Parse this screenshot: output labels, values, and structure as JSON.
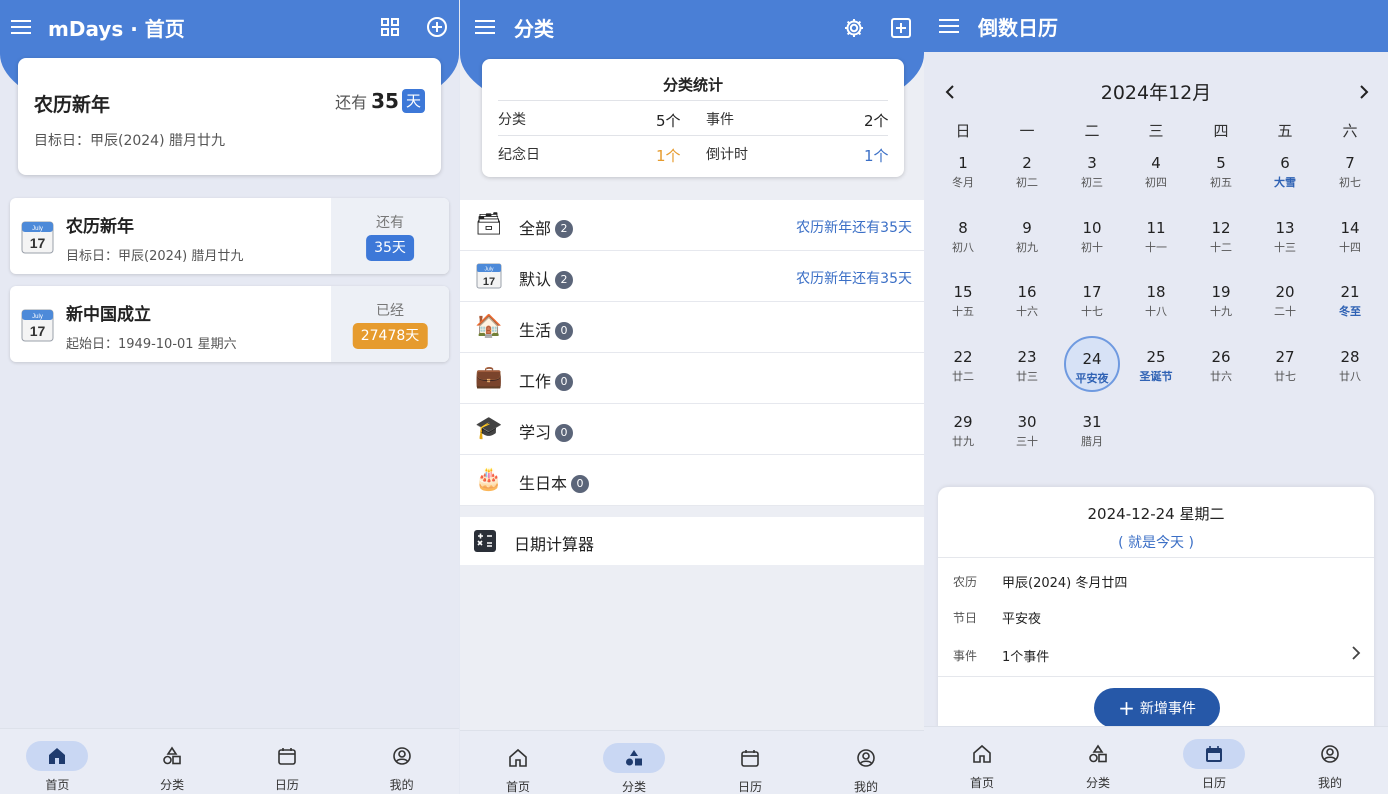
{
  "home": {
    "title": "mDays · 首页",
    "hero": {
      "name": "农历新年",
      "prefix": "还有",
      "days": "35",
      "unit": "天",
      "sub": "目标日：甲辰(2024) 腊月廿九"
    },
    "events": [
      {
        "name": "农历新年",
        "sub": "目标日：甲辰(2024) 腊月廿九",
        "label": "还有",
        "days": "35天",
        "color": "blue"
      },
      {
        "name": "新中国成立",
        "sub": "起始日：1949-10-01 星期六",
        "label": "已经",
        "days": "27478天",
        "color": "orange"
      }
    ]
  },
  "category": {
    "title": "分类",
    "stats": {
      "title": "分类统计",
      "r1": {
        "k1": "分类",
        "v1": "5个",
        "k2": "事件",
        "v2": "2个"
      },
      "r2": {
        "k1": "纪念日",
        "v1": "1个",
        "k2": "倒计时",
        "v2": "1个"
      }
    },
    "items": [
      {
        "name": "全部",
        "count": "2",
        "right": "农历新年还有35天",
        "icon": "archive-icon",
        "glyph": "🗃"
      },
      {
        "name": "默认",
        "count": "2",
        "right": "农历新年还有35天",
        "icon": "calendar-icon",
        "glyph": ""
      },
      {
        "name": "生活",
        "count": "0",
        "right": "",
        "icon": "house-icon",
        "glyph": "🏠"
      },
      {
        "name": "工作",
        "count": "0",
        "right": "",
        "icon": "briefcase-icon",
        "glyph": "💼"
      },
      {
        "name": "学习",
        "count": "0",
        "right": "",
        "icon": "graduation-cap-icon",
        "glyph": "🎓"
      },
      {
        "name": "生日本",
        "count": "0",
        "right": "",
        "icon": "birthday-cake-icon",
        "glyph": "🎂"
      }
    ],
    "calculator": "日期计算器"
  },
  "calendar": {
    "title": "倒数日历",
    "month": "2024年12月",
    "weekdays": [
      "日",
      "一",
      "二",
      "三",
      "四",
      "五",
      "六"
    ],
    "days": [
      {
        "n": "1",
        "l": "冬月"
      },
      {
        "n": "2",
        "l": "初二"
      },
      {
        "n": "3",
        "l": "初三"
      },
      {
        "n": "4",
        "l": "初四"
      },
      {
        "n": "5",
        "l": "初五"
      },
      {
        "n": "6",
        "l": "大雪",
        "hl": true
      },
      {
        "n": "7",
        "l": "初七"
      },
      {
        "n": "8",
        "l": "初八"
      },
      {
        "n": "9",
        "l": "初九"
      },
      {
        "n": "10",
        "l": "初十"
      },
      {
        "n": "11",
        "l": "十一"
      },
      {
        "n": "12",
        "l": "十二"
      },
      {
        "n": "13",
        "l": "十三"
      },
      {
        "n": "14",
        "l": "十四"
      },
      {
        "n": "15",
        "l": "十五"
      },
      {
        "n": "16",
        "l": "十六"
      },
      {
        "n": "17",
        "l": "十七"
      },
      {
        "n": "18",
        "l": "十八"
      },
      {
        "n": "19",
        "l": "十九"
      },
      {
        "n": "20",
        "l": "二十"
      },
      {
        "n": "21",
        "l": "冬至",
        "hl": true
      },
      {
        "n": "22",
        "l": "廿二"
      },
      {
        "n": "23",
        "l": "廿三"
      },
      {
        "n": "24",
        "l": "平安夜",
        "hl": true,
        "sel": true
      },
      {
        "n": "25",
        "l": "圣诞节",
        "hl": true
      },
      {
        "n": "26",
        "l": "廿六"
      },
      {
        "n": "27",
        "l": "廿七"
      },
      {
        "n": "28",
        "l": "廿八"
      },
      {
        "n": "29",
        "l": "廿九"
      },
      {
        "n": "30",
        "l": "三十"
      },
      {
        "n": "31",
        "l": "腊月"
      }
    ],
    "detail": {
      "date": "2024-12-24 星期二",
      "today": "( 就是今天 )",
      "lunar_k": "农历",
      "lunar_v": "甲辰(2024) 冬月廿四",
      "fest_k": "节日",
      "fest_v": "平安夜",
      "event_k": "事件",
      "event_v": "1个事件",
      "add": "新增事件"
    }
  },
  "nav": [
    "首页",
    "分类",
    "日历",
    "我的"
  ],
  "colors": {
    "appbar": "#4a7fd6",
    "accent": "#3d78d8",
    "orange": "#e69b2e",
    "link": "#3b6fc6",
    "add_button": "#2658a8"
  }
}
